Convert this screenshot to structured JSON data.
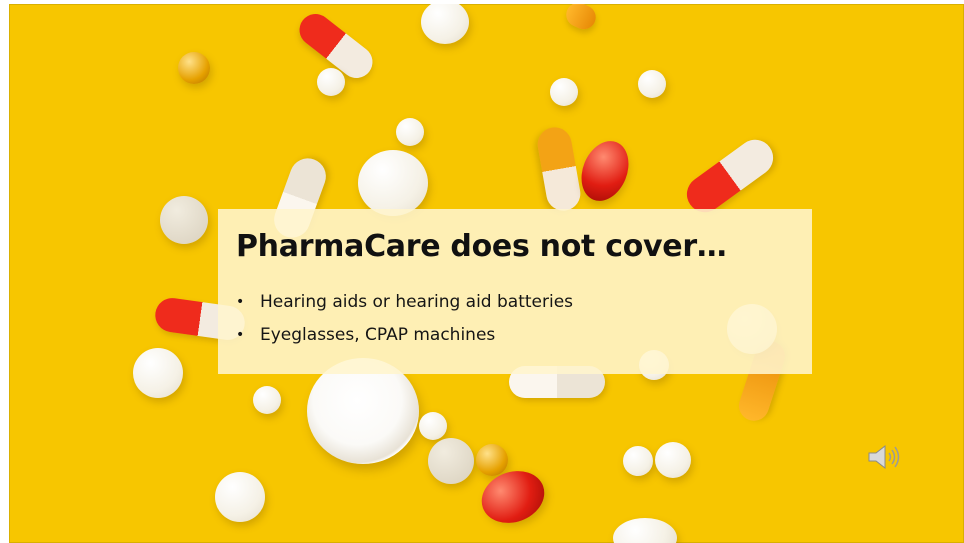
{
  "slide": {
    "title": "PharmaCare does not cover…",
    "bullets": [
      "Hearing aids or hearing aid batteries",
      "Eyeglasses, CPAP machines"
    ],
    "bullet_marker": "•"
  },
  "icons": {
    "audio": "speaker-icon"
  },
  "colors": {
    "background": "#f7c600",
    "text_box": "#fff5cd",
    "title_text": "#111111"
  }
}
